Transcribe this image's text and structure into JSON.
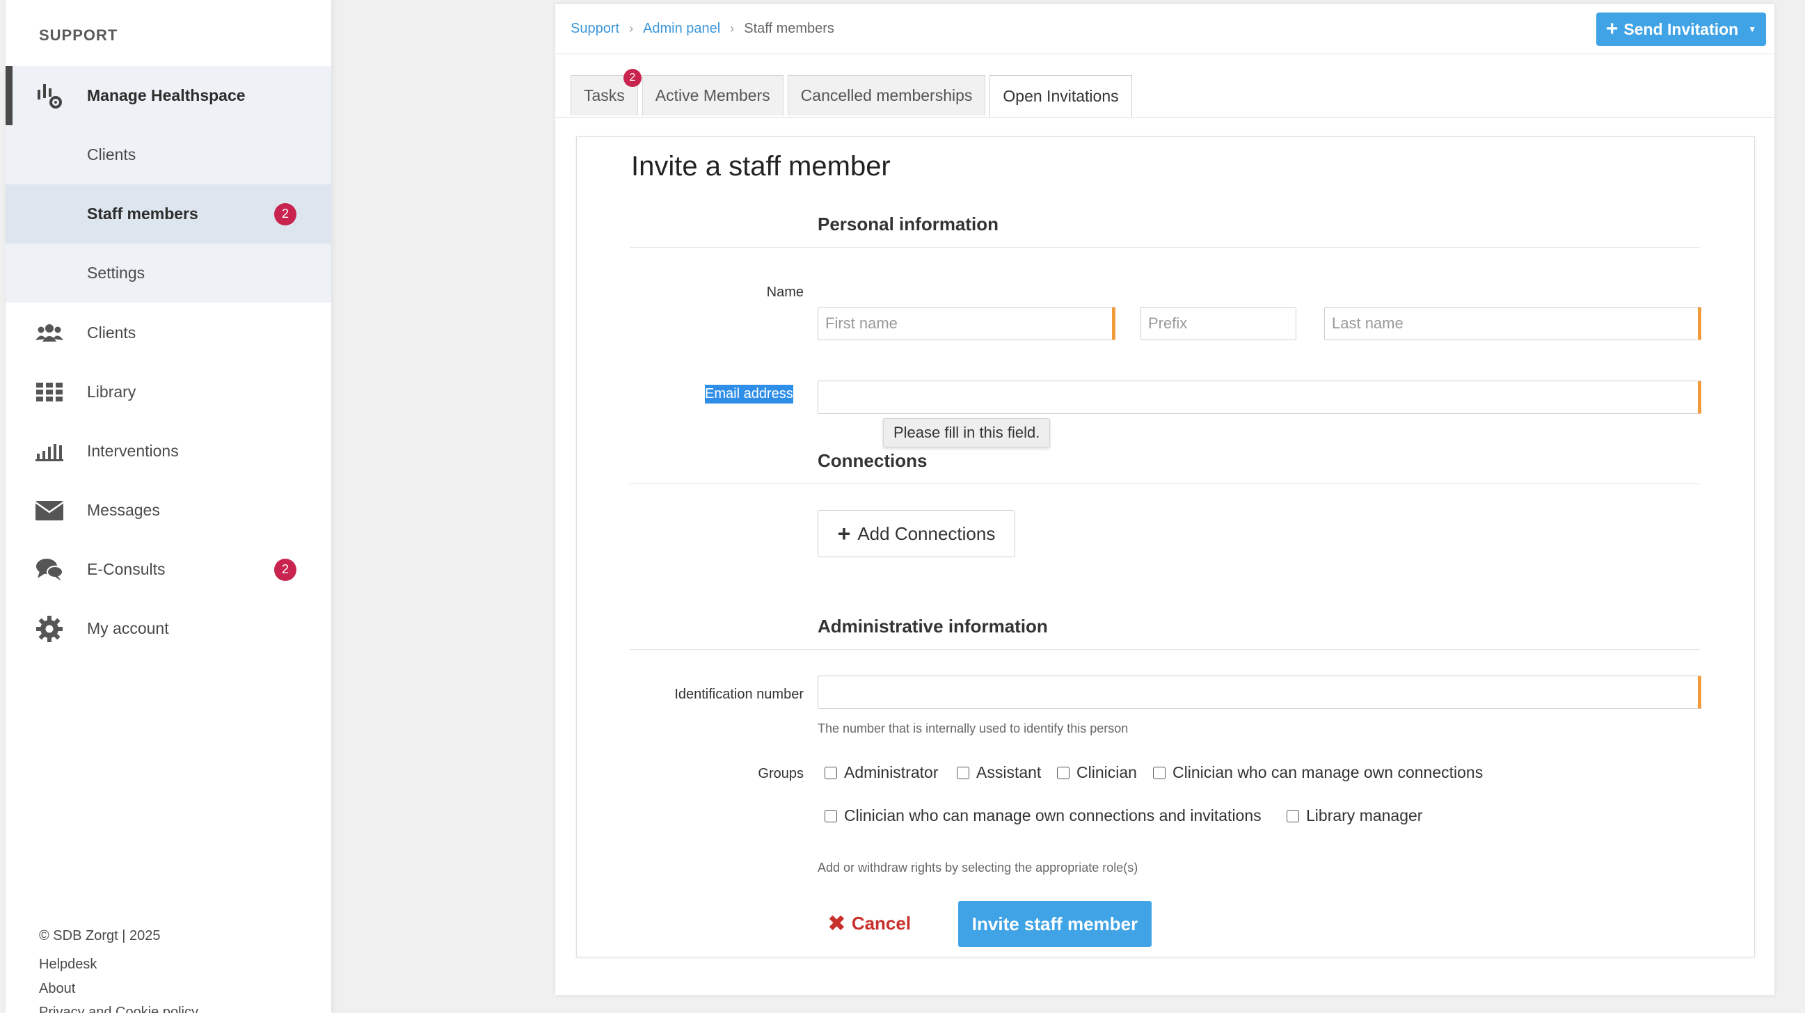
{
  "sidebar": {
    "heading": "SUPPORT",
    "manage_label": "Manage Healthspace",
    "sub_items": [
      {
        "label": "Clients"
      },
      {
        "label": "Staff members",
        "badge": "2"
      },
      {
        "label": "Settings"
      }
    ],
    "items": [
      {
        "label": "Clients",
        "icon": "users-icon"
      },
      {
        "label": "Library",
        "icon": "grid-icon"
      },
      {
        "label": "Interventions",
        "icon": "interventions-icon"
      },
      {
        "label": "Messages",
        "icon": "envelope-icon"
      },
      {
        "label": "E-Consults",
        "icon": "chat-icon",
        "badge": "2"
      },
      {
        "label": "My account",
        "icon": "gear-icon"
      }
    ],
    "footer": {
      "copyright": "© SDB Zorgt | 2025",
      "helpdesk": "Helpdesk",
      "about": "About",
      "privacy": "Privacy and Cookie policy"
    }
  },
  "breadcrumb": {
    "support": "Support",
    "admin": "Admin panel",
    "current": "Staff members"
  },
  "send_invitation": "Send Invitation",
  "tabs": [
    {
      "label": "Tasks",
      "badge": "2"
    },
    {
      "label": "Active Members"
    },
    {
      "label": "Cancelled memberships"
    },
    {
      "label": "Open Invitations",
      "active": true
    }
  ],
  "form": {
    "title": "Invite a staff member",
    "personal_title": "Personal information",
    "name_label": "Name",
    "first_name_placeholder": "First name",
    "prefix_placeholder": "Prefix",
    "last_name_placeholder": "Last name",
    "email_label": "Email address",
    "email_value": "",
    "tooltip": "Please fill in this field.",
    "connections_title": "Connections",
    "add_connections": "Add Connections",
    "admin_title": "Administrative information",
    "id_label": "Identification number",
    "id_help": "The number that is internally used to identify this person",
    "groups_label": "Groups",
    "groups": [
      "Administrator",
      "Assistant",
      "Clinician",
      "Clinician who can manage own connections",
      "Clinician who can manage own connections and invitations",
      "Library manager"
    ],
    "groups_help": "Add or withdraw rights by selecting the appropriate role(s)",
    "cancel": "Cancel",
    "submit": "Invite staff member"
  },
  "colors": {
    "accent": "#3fa3e6",
    "badge": "#c8244f",
    "required": "#f29b3c",
    "cancel": "#c9302c"
  }
}
